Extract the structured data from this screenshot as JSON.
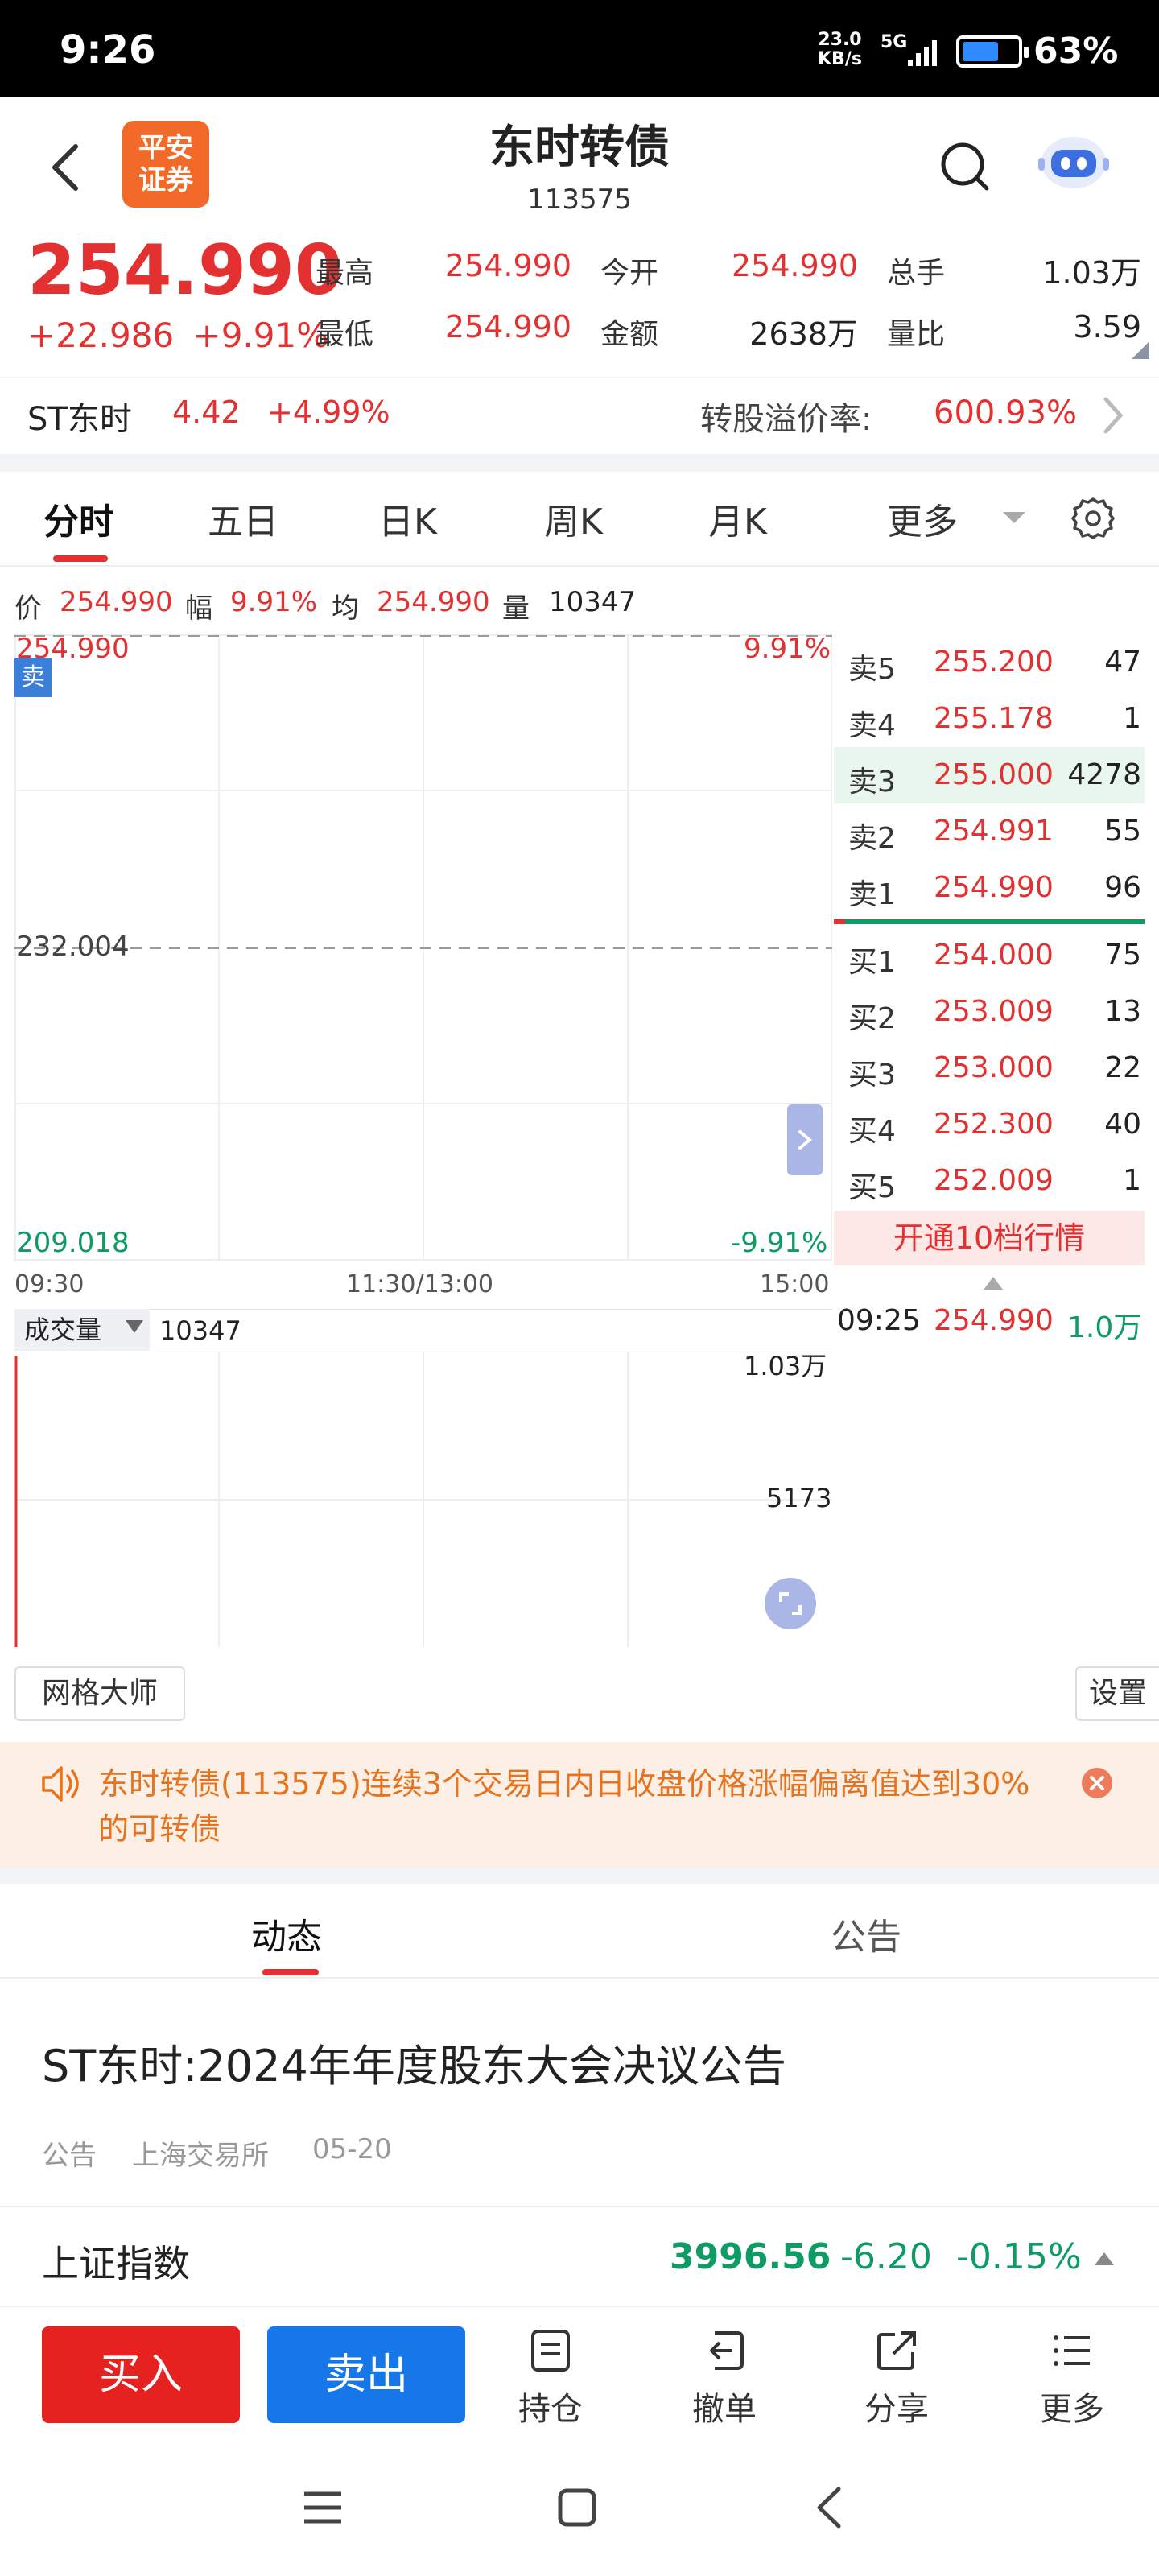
{
  "status_bar": {
    "time": "9:26",
    "net_speed": "23.0",
    "net_unit": "KB/s",
    "signal": "5G",
    "battery": "63%"
  },
  "header": {
    "logo_text_1": "平安",
    "logo_text_2": "证券",
    "title": "东时转债",
    "code": "113575"
  },
  "quote": {
    "price": "254.990",
    "change": "+22.986",
    "change_pct": "+9.91%",
    "high_label": "最高",
    "high": "254.990",
    "open_label": "今开",
    "open": "254.990",
    "vol_label": "总手",
    "vol": "1.03万",
    "low_label": "最低",
    "low": "254.990",
    "amount_label": "金额",
    "amount": "2638万",
    "ratio_label": "量比",
    "ratio": "3.59"
  },
  "stock": {
    "name": "ST东时",
    "price": "4.42",
    "pct": "+4.99%",
    "premium_label": "转股溢价率:",
    "premium": "600.93%"
  },
  "tabs": [
    "分时",
    "五日",
    "日K",
    "周K",
    "月K",
    "更多"
  ],
  "info_line": {
    "p_label": "价",
    "p": "254.990",
    "f_label": "幅",
    "f": "9.91%",
    "a_label": "均",
    "a": "254.990",
    "v_label": "量",
    "v": "10347"
  },
  "chart": {
    "top_price": "254.990",
    "top_pct": "9.91%",
    "mid_price": "232.004",
    "bottom_price": "209.018",
    "bottom_pct": "-9.91%",
    "ask_tag": "卖",
    "time_start": "09:30",
    "time_mid": "11:30/13:00",
    "time_end": "15:00"
  },
  "volume": {
    "selector": "成交量",
    "value": "10347",
    "top_label": "1.03万",
    "mid_label": "5173"
  },
  "order_book": {
    "asks": [
      {
        "label": "卖5",
        "price": "255.200",
        "vol": "47"
      },
      {
        "label": "卖4",
        "price": "255.178",
        "vol": "1"
      },
      {
        "label": "卖3",
        "price": "255.000",
        "vol": "4278"
      },
      {
        "label": "卖2",
        "price": "254.991",
        "vol": "55"
      },
      {
        "label": "卖1",
        "price": "254.990",
        "vol": "96"
      }
    ],
    "bids": [
      {
        "label": "买1",
        "price": "254.000",
        "vol": "75"
      },
      {
        "label": "买2",
        "price": "253.009",
        "vol": "13"
      },
      {
        "label": "买3",
        "price": "253.000",
        "vol": "22"
      },
      {
        "label": "买4",
        "price": "252.300",
        "vol": "40"
      },
      {
        "label": "买5",
        "price": "252.009",
        "vol": "1"
      }
    ],
    "open10": "开通10档行情",
    "tick": {
      "time": "09:25",
      "price": "254.990",
      "vol": "1.0万"
    }
  },
  "grid": {
    "master": "网格大师",
    "settings": "设置"
  },
  "notice": {
    "text": "东时转债(113575)连续3个交易日内日收盘价格涨幅偏离值达到30%的可转债"
  },
  "bottom_tabs": [
    "动态",
    "公告"
  ],
  "news": {
    "title": "ST东时:2024年年度股东大会决议公告",
    "type": "公告",
    "source": "上海交易所",
    "date": "05-20"
  },
  "index_bar": {
    "name": "上证指数",
    "value": "3996.56",
    "change": "-6.20",
    "pct": "-0.15%"
  },
  "actions": {
    "buy": "买入",
    "sell": "卖出",
    "position": "持仓",
    "cancel": "撤单",
    "share": "分享",
    "more": "更多"
  },
  "colors": {
    "up": "#e33131",
    "down": "#0e9c64",
    "buy": "#e5221f",
    "sell": "#1877e8",
    "brand": "#f26a2a"
  }
}
